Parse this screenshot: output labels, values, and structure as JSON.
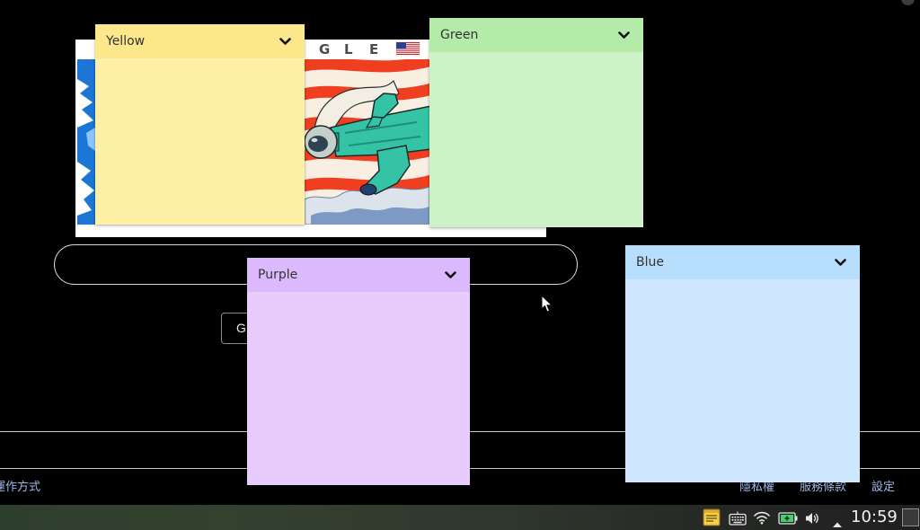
{
  "page": {
    "background_color": "#000000"
  },
  "doodle": {
    "visible_letters": [
      "G",
      "L",
      "E"
    ],
    "flag_icon": "us-flag-icon"
  },
  "search": {
    "button_label": "G"
  },
  "footer": {
    "left_link": "運作方式",
    "right_links": [
      "隱私權",
      "服務條款",
      "設定"
    ],
    "link_color": "#9fb8ea"
  },
  "notes": [
    {
      "title": "Yellow",
      "header_color": "#fde78b",
      "body_color": "#fef1a6",
      "menu_icon": "chevron-down-icon"
    },
    {
      "title": "Green",
      "header_color": "#b4eba9",
      "body_color": "#cdf2c7",
      "menu_icon": "chevron-down-icon"
    },
    {
      "title": "Purple",
      "header_color": "#dcb8fc",
      "body_color": "#e8ccfd",
      "menu_icon": "chevron-down-icon"
    },
    {
      "title": "Blue",
      "header_color": "#b8defd",
      "body_color": "#cfe7fe",
      "menu_icon": "chevron-down-icon"
    }
  ],
  "taskbar": {
    "tray_icons": [
      "sticky-notes-icon",
      "keyboard-icon",
      "wifi-icon",
      "battery-icon",
      "volume-icon",
      "tray-expand-icon"
    ],
    "clock": "10:59",
    "show_desktop_icon": "show-desktop-icon"
  }
}
